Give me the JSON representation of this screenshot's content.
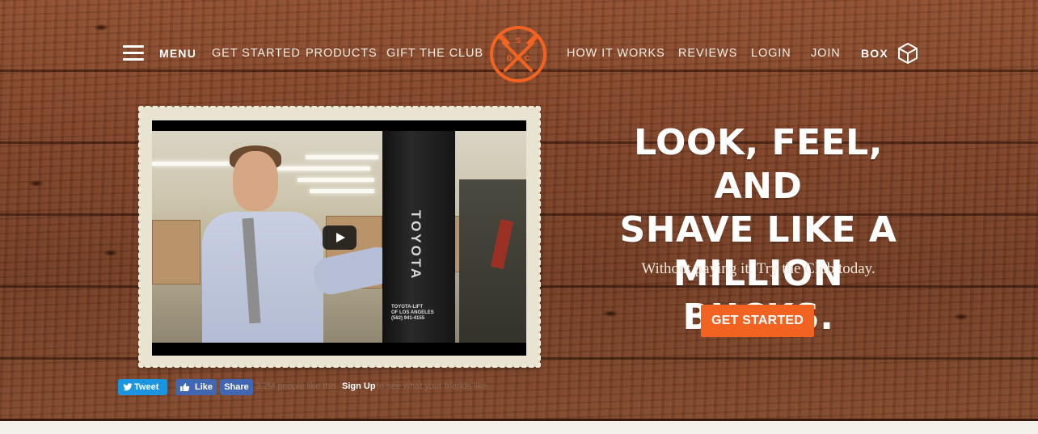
{
  "nav": {
    "menu_label": "MENU",
    "links": [
      "GET STARTED",
      "PRODUCTS",
      "GIFT THE CLUB",
      "HOW IT WORKS",
      "REVIEWS",
      "LOGIN",
      "JOIN"
    ],
    "box_label": "BOX",
    "logo_letters": [
      "S",
      "D",
      "C"
    ]
  },
  "video": {
    "forklift_text": "TOYOTA",
    "forklift_small": [
      "TOYOTA-LIFT",
      "OF LOS ANGELES",
      "(562) 941-4155"
    ]
  },
  "hero": {
    "headline_lines": [
      "LOOK, FEEL, AND",
      "SHAVE LIKE A",
      "MILLION BUCKS."
    ],
    "subline": "Without paying it. Try the Club today.",
    "cta_label": "GET STARTED"
  },
  "social": {
    "tweet_label": "Tweet",
    "like_label": "Like",
    "share_label": "Share",
    "like_count_text": "3.2M people like this.",
    "signup_label": "Sign Up",
    "signup_rest": "to see what your friends like."
  },
  "colors": {
    "accent": "#f26322",
    "twitter": "#1b95e0",
    "facebook": "#4267b2"
  },
  "icons": [
    "hamburger-icon",
    "logo-crossed-razors-icon",
    "box-cube-icon",
    "play-icon",
    "twitter-bird-icon",
    "thumbs-up-icon"
  ]
}
